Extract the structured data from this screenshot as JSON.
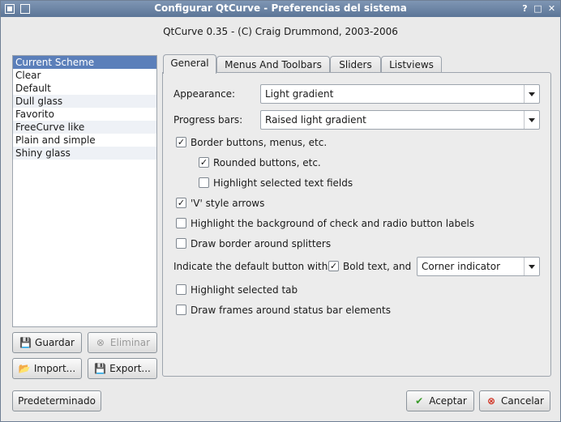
{
  "window": {
    "title": "Configurar QtCurve - Preferencias del sistema",
    "help": "?",
    "maximize": "□",
    "close": "✕"
  },
  "header": {
    "text": "QtCurve 0.35 - (C) Craig Drummond, 2003-2006"
  },
  "schemes": {
    "items": [
      "Current Scheme",
      "Clear",
      "Default",
      "Dull glass",
      "Favorito",
      "FreeCurve like",
      "Plain and simple",
      "Shiny glass"
    ],
    "selected": "Current Scheme"
  },
  "scheme_buttons": {
    "save": "Guardar",
    "delete": "Eliminar",
    "import": "Import...",
    "export": "Export..."
  },
  "tabs": [
    "General",
    "Menus And Toolbars",
    "Sliders",
    "Listviews"
  ],
  "general": {
    "appearance_label": "Appearance:",
    "appearance_value": "Light gradient",
    "progress_label": "Progress bars:",
    "progress_value": "Raised light gradient",
    "border_buttons": "Border buttons, menus, etc.",
    "rounded_buttons": "Rounded buttons, etc.",
    "highlight_text_fields": "Highlight selected text fields",
    "v_arrows": "'V' style arrows",
    "highlight_check_bg": "Highlight the background of check and radio button labels",
    "border_splitters": "Draw border around splitters",
    "default_button_label": "Indicate the default button with:",
    "bold_text": "Bold text, and",
    "indicator_value": "Corner indicator",
    "highlight_tab": "Highlight selected tab",
    "status_frames": "Draw frames around status bar elements",
    "checks": {
      "border_buttons": true,
      "rounded_buttons": true,
      "highlight_text_fields": false,
      "v_arrows": true,
      "highlight_check_bg": false,
      "border_splitters": false,
      "bold_text": true,
      "highlight_tab": false,
      "status_frames": false
    }
  },
  "footer": {
    "defaults": "Predeterminado",
    "accept": "Aceptar",
    "cancel": "Cancelar"
  },
  "colors": {
    "titlebar": "#6a84a6",
    "selection": "#5b7fba",
    "accept_icon": "#3a9a2a",
    "cancel_icon": "#d03020"
  }
}
